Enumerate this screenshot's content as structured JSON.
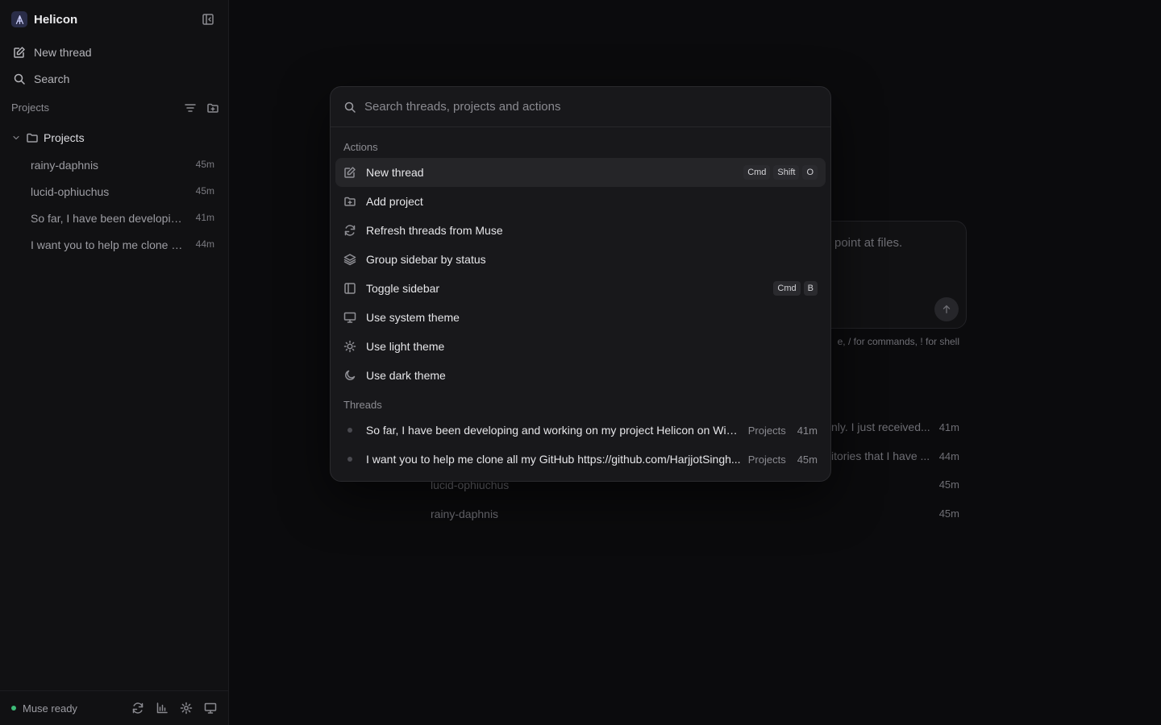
{
  "sidebar": {
    "app_name": "Helicon",
    "nav": {
      "new_thread": "New thread",
      "search": "Search"
    },
    "section_label": "Projects",
    "folder_name": "Projects",
    "threads": [
      {
        "title": "rainy-daphnis",
        "ago": "45m"
      },
      {
        "title": "lucid-ophiuchus",
        "ago": "45m"
      },
      {
        "title": "So far, I have been developin...",
        "ago": "41m"
      },
      {
        "title": "I want you to help me clone al...",
        "ago": "44m"
      }
    ],
    "status": "Muse ready",
    "status_color": "#3dbb77"
  },
  "main": {
    "composer_placeholder_partial": "point at files.",
    "composer_hint_partial": "e, / for commands, ! for shell",
    "recent": [
      {
        "title_partial": "nly. I just received...",
        "ago": "41m"
      },
      {
        "title_partial": "itories that I have ...",
        "ago": "44m"
      },
      {
        "title": "lucid-ophiuchus",
        "ago": "45m"
      },
      {
        "title": "rainy-daphnis",
        "ago": "45m"
      }
    ]
  },
  "palette": {
    "search_placeholder": "Search threads, projects and actions",
    "actions_label": "Actions",
    "actions": [
      {
        "label": "New thread",
        "icon": "edit-icon",
        "shortcut": [
          "Cmd",
          "Shift",
          "O"
        ]
      },
      {
        "label": "Add project",
        "icon": "folder-plus-icon"
      },
      {
        "label": "Refresh threads from Muse",
        "icon": "refresh-icon"
      },
      {
        "label": "Group sidebar by status",
        "icon": "layers-icon"
      },
      {
        "label": "Toggle sidebar",
        "icon": "sidebar-icon",
        "shortcut": [
          "Cmd",
          "B"
        ]
      },
      {
        "label": "Use system theme",
        "icon": "monitor-icon"
      },
      {
        "label": "Use light theme",
        "icon": "sun-icon"
      },
      {
        "label": "Use dark theme",
        "icon": "moon-icon"
      }
    ],
    "threads_label": "Threads",
    "threads": [
      {
        "title": "So far, I have been developing and working on my project Helicon on Wind...",
        "project": "Projects",
        "ago": "41m"
      },
      {
        "title": "I want you to help me clone all my GitHub https://github.com/HarjjotSingh...",
        "project": "Projects",
        "ago": "45m"
      }
    ]
  }
}
